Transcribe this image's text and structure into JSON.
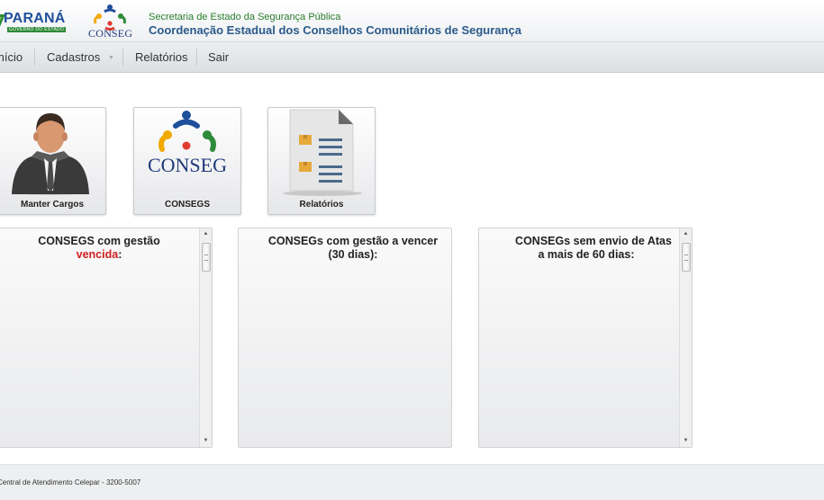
{
  "header": {
    "brand_text": "PARANÁ",
    "brand_sub": "GOVERNO DO ESTADO",
    "conseg_logo_text": "CONSEG",
    "line1": "Secretaria de Estado da Segurança Pública",
    "line2": "Coordenação Estadual dos Conselhos Comunitários de Segurança"
  },
  "nav": {
    "items": [
      {
        "label": "Início"
      },
      {
        "label": "Cadastros"
      },
      {
        "label": "Relatórios"
      },
      {
        "label": "Sair"
      }
    ]
  },
  "tiles": [
    {
      "label": "Manter Cargos",
      "icon": "businessman-icon"
    },
    {
      "label": "CONSEGS",
      "icon": "conseg-logo-icon",
      "logo_text": "CONSEG"
    },
    {
      "label": "Relatórios",
      "icon": "report-document-icon"
    }
  ],
  "panels": [
    {
      "title_line1": "CONSEGS com gestão",
      "title_highlight": "vencida",
      "title_suffix": ":"
    },
    {
      "title_line1": "CONSEGs com gestão a vencer",
      "title_line2": "(30 dias):"
    },
    {
      "title_line1": "CONSEGs sem envio de Atas",
      "title_line2": "a mais de 60 dias:"
    }
  ],
  "footer": {
    "text": "Central de Atendimento Celepar - 3200-5007"
  },
  "colors": {
    "header_green": "#2a7d2e",
    "header_blue": "#2a5a8a",
    "alert_red": "#d02020"
  }
}
